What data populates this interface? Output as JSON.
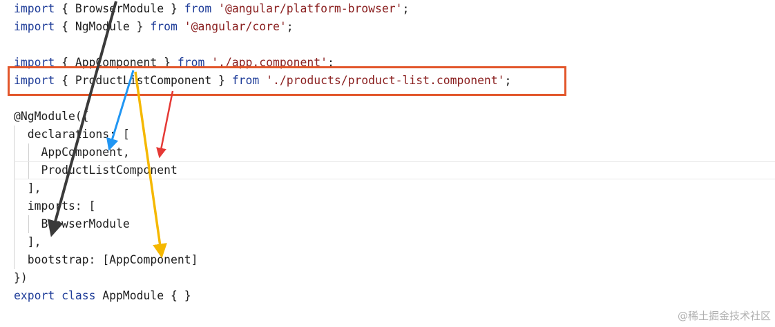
{
  "code": {
    "line1": {
      "k1": "import",
      "a": " { BrowserModule } ",
      "k2": "from",
      "b": " ",
      "s": "'@angular/platform-browser'",
      "c": ";"
    },
    "line2": {
      "k1": "import",
      "a": " { NgModule } ",
      "k2": "from",
      "b": " ",
      "s": "'@angular/core'",
      "c": ";"
    },
    "line3": {
      "k1": "import",
      "a": " { AppComponent } ",
      "k2": "from",
      "b": " ",
      "s": "'./app.component'",
      "c": ";"
    },
    "line4": {
      "k1": "import",
      "a": " { ProductListComponent } ",
      "k2": "from",
      "b": " ",
      "s": "'./products/product-list.component'",
      "c": ";"
    },
    "line5": "@NgModule({",
    "line6": "  declarations: [",
    "line7": "    AppComponent,",
    "line8": "    ProductListComponent",
    "line9": "  ],",
    "line10": "  imports: [",
    "line11": "    BrowserModule",
    "line12": "  ],",
    "line13": "  bootstrap: [AppComponent]",
    "line14": "})",
    "line15": {
      "k1": "export",
      "sp1": " ",
      "k2": "class",
      "rest": " AppModule { }"
    }
  },
  "colors": {
    "keyword": "#1f3d99",
    "string": "#8a1f1f",
    "highlight_box": "#e2562a",
    "arrow_black": "#3a3a3a",
    "arrow_blue": "#2196f3",
    "arrow_red": "#e53935",
    "arrow_yellow": "#f5b800"
  },
  "watermark": "@稀土掘金技术社区"
}
